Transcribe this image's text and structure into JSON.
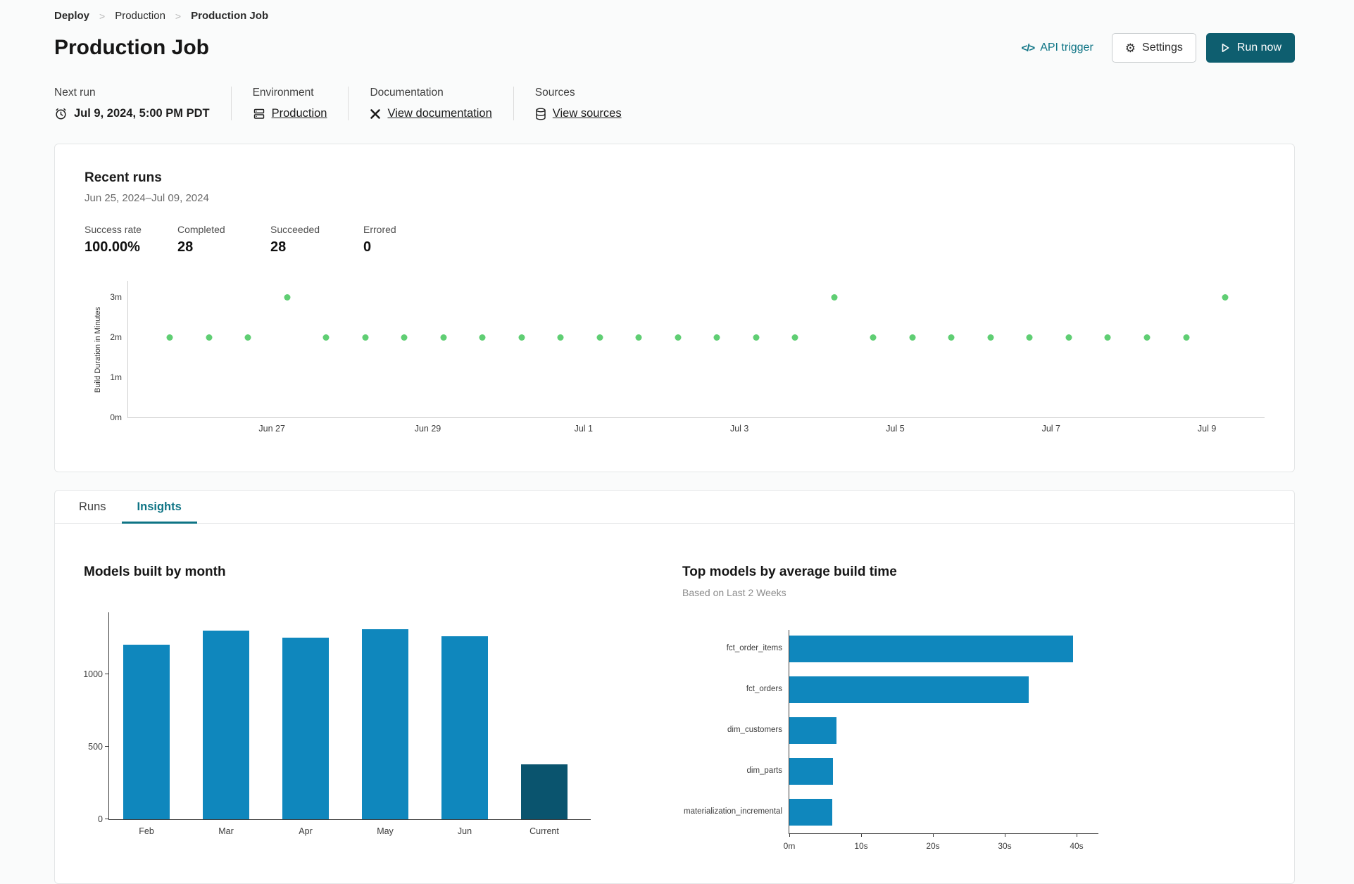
{
  "breadcrumb": {
    "items": [
      {
        "label": "Deploy"
      },
      {
        "label": "Production"
      },
      {
        "label": "Production Job"
      }
    ]
  },
  "icons": {
    "breadcrumb_separator": ">",
    "code_glyph": "</>",
    "gear_glyph": "⚙"
  },
  "header": {
    "title": "Production Job",
    "api_trigger_label": "API trigger",
    "settings_label": "Settings",
    "run_now_label": "Run now"
  },
  "meta": {
    "next_run": {
      "label": "Next run",
      "value": "Jul 9, 2024, 5:00 PM PDT"
    },
    "environment": {
      "label": "Environment",
      "value": "Production"
    },
    "documentation": {
      "label": "Documentation",
      "value": "View documentation"
    },
    "sources": {
      "label": "Sources",
      "value": "View sources"
    }
  },
  "recent_runs": {
    "title": "Recent runs",
    "date_range": "Jun 25, 2024–Jul 09, 2024",
    "stats": [
      {
        "label": "Success rate",
        "value": "100.00%"
      },
      {
        "label": "Completed",
        "value": "28"
      },
      {
        "label": "Succeeded",
        "value": "28"
      },
      {
        "label": "Errored",
        "value": "0"
      }
    ]
  },
  "tabs": [
    {
      "label": "Runs",
      "active": false
    },
    {
      "label": "Insights",
      "active": true
    }
  ],
  "colors": {
    "accent_teal": "#0e7485",
    "primary_button": "#0e5e6f",
    "run_dot_green": "#5fce73",
    "bar_blue": "#0f87bd",
    "bar_dark": "#0a546e"
  },
  "chart_data": [
    {
      "name": "recent_runs_scatter",
      "type": "scatter",
      "title": "Recent runs",
      "ylabel": "Build Duration in Minutes",
      "y_ticks": [
        "0m",
        "1m",
        "2m",
        "3m"
      ],
      "x_ticks": [
        "Jun 27",
        "Jun 29",
        "Jul 1",
        "Jul 3",
        "Jul 5",
        "Jul 7",
        "Jul 9"
      ],
      "ylim": [
        0,
        3.4
      ],
      "points_minutes": [
        2,
        2,
        2,
        3,
        2,
        2,
        2,
        2,
        2,
        2,
        2,
        2,
        2,
        2,
        2,
        2,
        2,
        3,
        2,
        2,
        2,
        2,
        2,
        2,
        2,
        2,
        2,
        3
      ],
      "point_color": "#5fce73",
      "legend": "none",
      "grid": false
    },
    {
      "name": "models_built_by_month",
      "type": "bar",
      "title": "Models built by month",
      "categories": [
        "Feb",
        "Mar",
        "Apr",
        "May",
        "Jun",
        "Current"
      ],
      "values": [
        1200,
        1300,
        1250,
        1310,
        1260,
        380
      ],
      "y_ticks": [
        0,
        500,
        1000
      ],
      "ylim": [
        0,
        1430
      ],
      "bar_color": "#0f87bd",
      "highlight_color": "#0a546e",
      "highlight_category": "Current",
      "grid": false
    },
    {
      "name": "top_models_by_avg_build_time",
      "type": "bar-horizontal",
      "title": "Top models by average build time",
      "subtitle": "Based on Last 2 Weeks",
      "categories": [
        "fct_order_items",
        "fct_orders",
        "dim_customers",
        "dim_parts",
        "materialization_incremental"
      ],
      "values_seconds": [
        39.5,
        33.3,
        6.6,
        6.1,
        6.0
      ],
      "x_ticks": [
        "0m",
        "10s",
        "20s",
        "30s",
        "40s"
      ],
      "xlim_seconds": [
        0,
        45
      ],
      "bar_color": "#0f87bd",
      "grid": false
    }
  ]
}
